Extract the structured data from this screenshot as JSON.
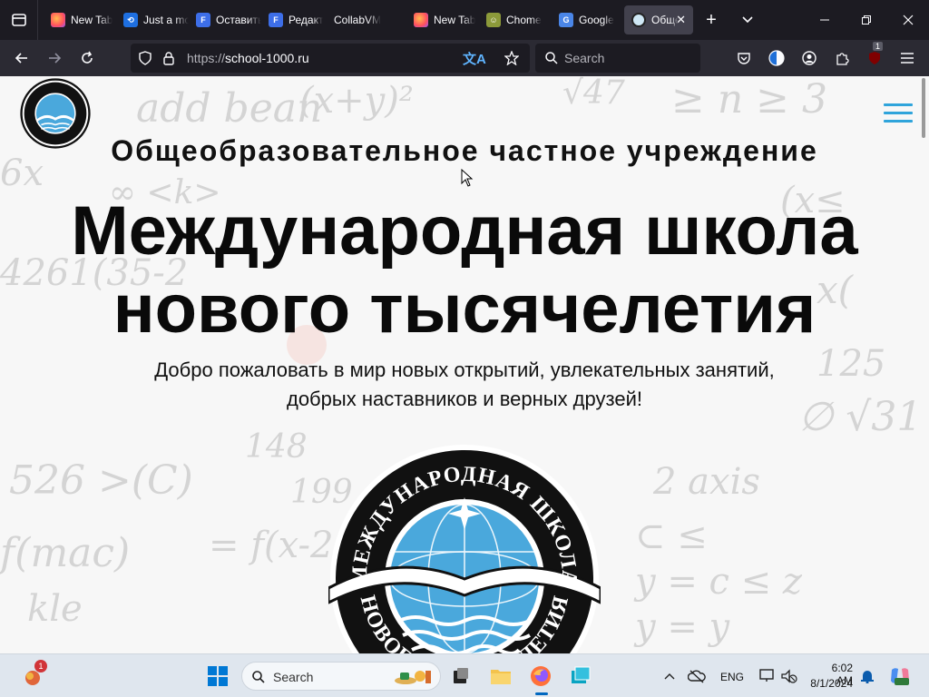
{
  "browser": {
    "tabs": [
      {
        "title": "New Tab",
        "favicon": "firefox-icon"
      },
      {
        "title": "Just a moment",
        "favicon": "link-icon"
      },
      {
        "title": "Оставить",
        "favicon": "f-app-icon"
      },
      {
        "title": "Редакт",
        "favicon": "f-app-icon"
      },
      {
        "title": "CollabVM",
        "favicon": "none"
      },
      {
        "title": "New Tab",
        "favicon": "firefox-icon"
      },
      {
        "title": "Chome",
        "favicon": "chome-icon"
      },
      {
        "title": "Google",
        "favicon": "google-translate-icon"
      },
      {
        "title": "Обще",
        "favicon": "school-globe-icon",
        "active": true
      }
    ],
    "url_scheme": "https://",
    "url_host": "school-1000.ru",
    "search_placeholder": "Search",
    "extension_badge": "1"
  },
  "page": {
    "subtitle": "Общеобразовательное частное учреждение",
    "title_line1": "Международная школа",
    "title_line2": "нового тысячелетия",
    "welcome_line1": "Добро пожаловать в мир новых открытий, увлекательных занятий,",
    "welcome_line2": "добрых наставников и верных друзей!",
    "logo_text_top": "МЕЖДУНАРОДНАЯ ШКОЛА",
    "logo_text_bottom": "НОВОГО ТЫСЯЧЕЛЕТИЯ",
    "accent_color": "#2fa4db"
  },
  "taskbar": {
    "search_placeholder": "Search",
    "widgets_badge": "1",
    "language": "ENG",
    "time": "6:02 AM",
    "date": "8/1/2024"
  }
}
